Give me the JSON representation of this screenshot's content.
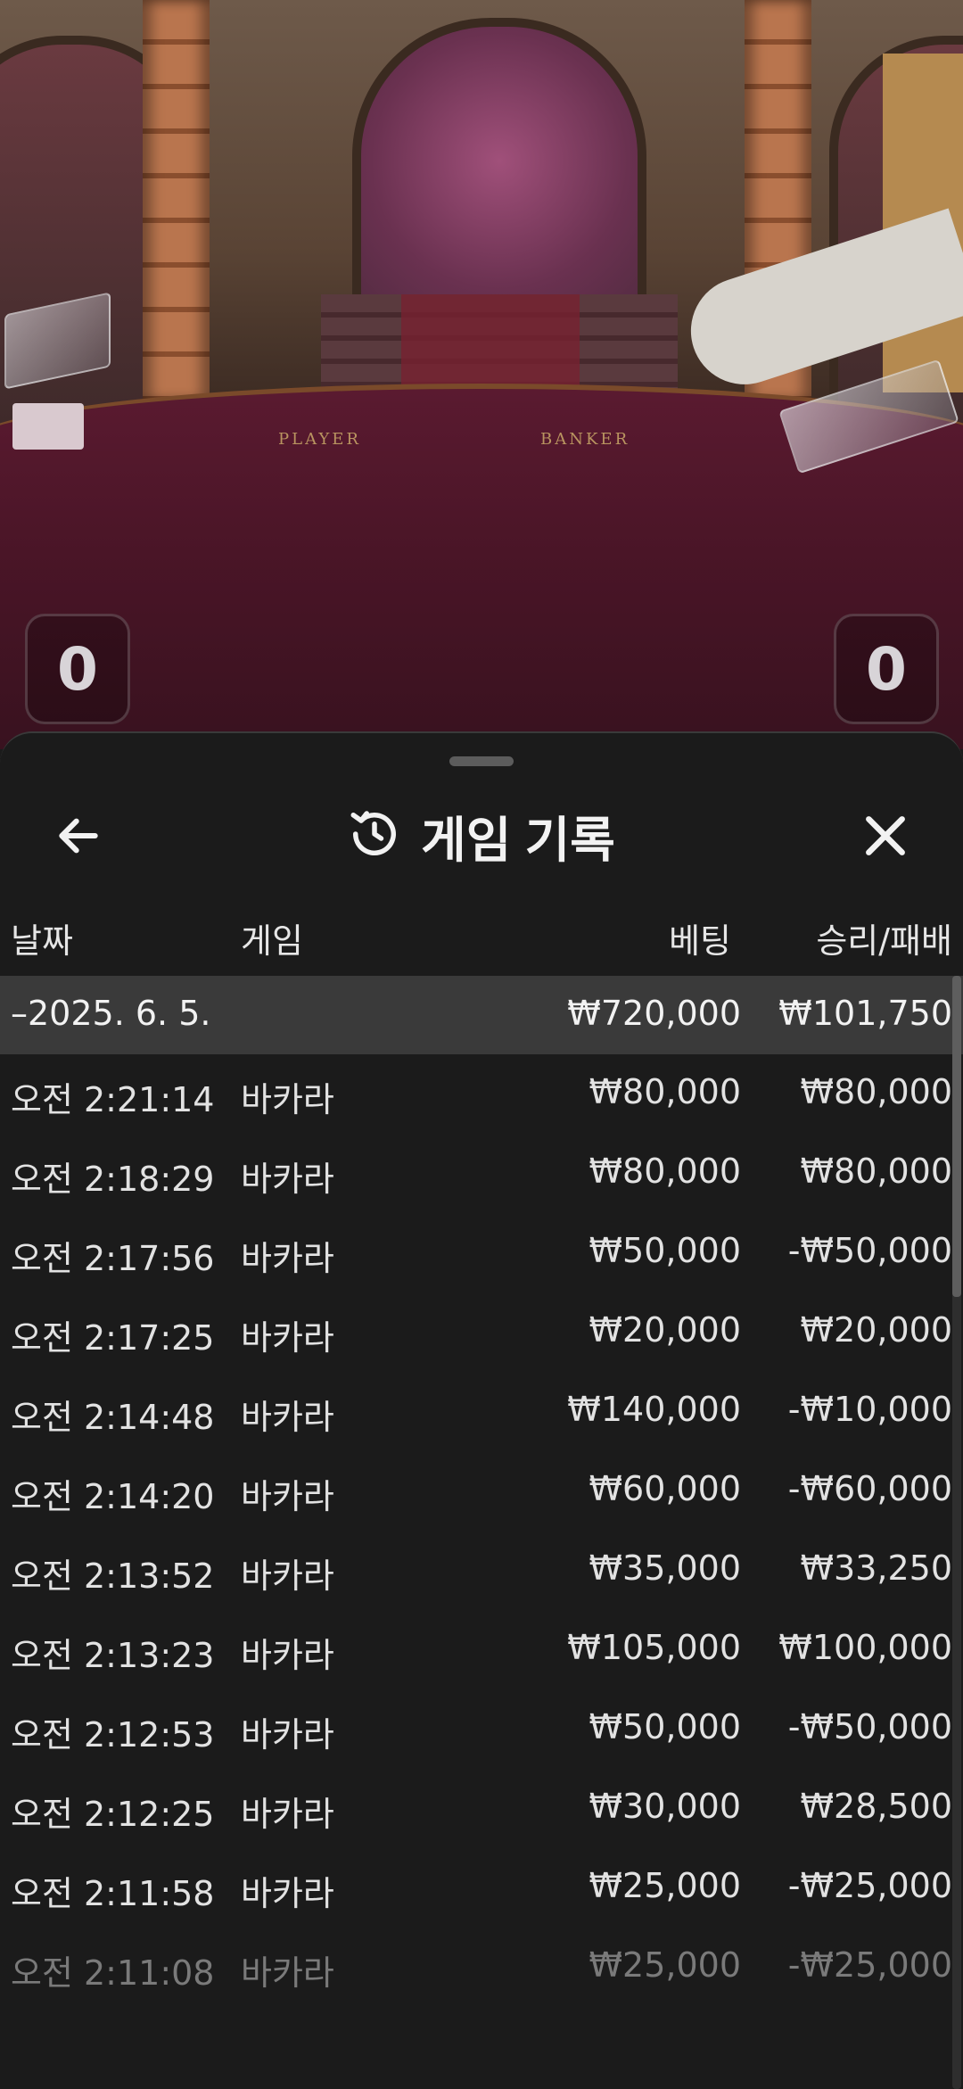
{
  "scene": {
    "table_labels": {
      "player": "PLAYER",
      "banker": "BANKER"
    },
    "scores": {
      "player": "0",
      "banker": "0"
    }
  },
  "history": {
    "title": "게임 기록",
    "icons": {
      "back": "arrow-left-icon",
      "title": "history-icon",
      "close": "close-icon"
    },
    "columns": {
      "date": "날짜",
      "game": "게임",
      "bet": "베팅",
      "win_loss": "승리/패배"
    },
    "summary": {
      "date": "–2025. 6. 5.",
      "bet": "₩720,000",
      "win_loss": "₩101,750"
    },
    "rows": [
      {
        "time": "오전 2:21:14",
        "game": "바카라",
        "bet": "₩80,000",
        "win_loss": "₩80,000"
      },
      {
        "time": "오전 2:18:29",
        "game": "바카라",
        "bet": "₩80,000",
        "win_loss": "₩80,000"
      },
      {
        "time": "오전 2:17:56",
        "game": "바카라",
        "bet": "₩50,000",
        "win_loss": "-₩50,000"
      },
      {
        "time": "오전 2:17:25",
        "game": "바카라",
        "bet": "₩20,000",
        "win_loss": "₩20,000"
      },
      {
        "time": "오전 2:14:48",
        "game": "바카라",
        "bet": "₩140,000",
        "win_loss": "-₩10,000"
      },
      {
        "time": "오전 2:14:20",
        "game": "바카라",
        "bet": "₩60,000",
        "win_loss": "-₩60,000"
      },
      {
        "time": "오전 2:13:52",
        "game": "바카라",
        "bet": "₩35,000",
        "win_loss": "₩33,250"
      },
      {
        "time": "오전 2:13:23",
        "game": "바카라",
        "bet": "₩105,000",
        "win_loss": "₩100,000"
      },
      {
        "time": "오전 2:12:53",
        "game": "바카라",
        "bet": "₩50,000",
        "win_loss": "-₩50,000"
      },
      {
        "time": "오전 2:12:25",
        "game": "바카라",
        "bet": "₩30,000",
        "win_loss": "₩28,500"
      },
      {
        "time": "오전 2:11:58",
        "game": "바카라",
        "bet": "₩25,000",
        "win_loss": "-₩25,000"
      },
      {
        "time": "오전 2:11:08",
        "game": "바카라",
        "bet": "₩25,000",
        "win_loss": "-₩25,000"
      }
    ]
  }
}
